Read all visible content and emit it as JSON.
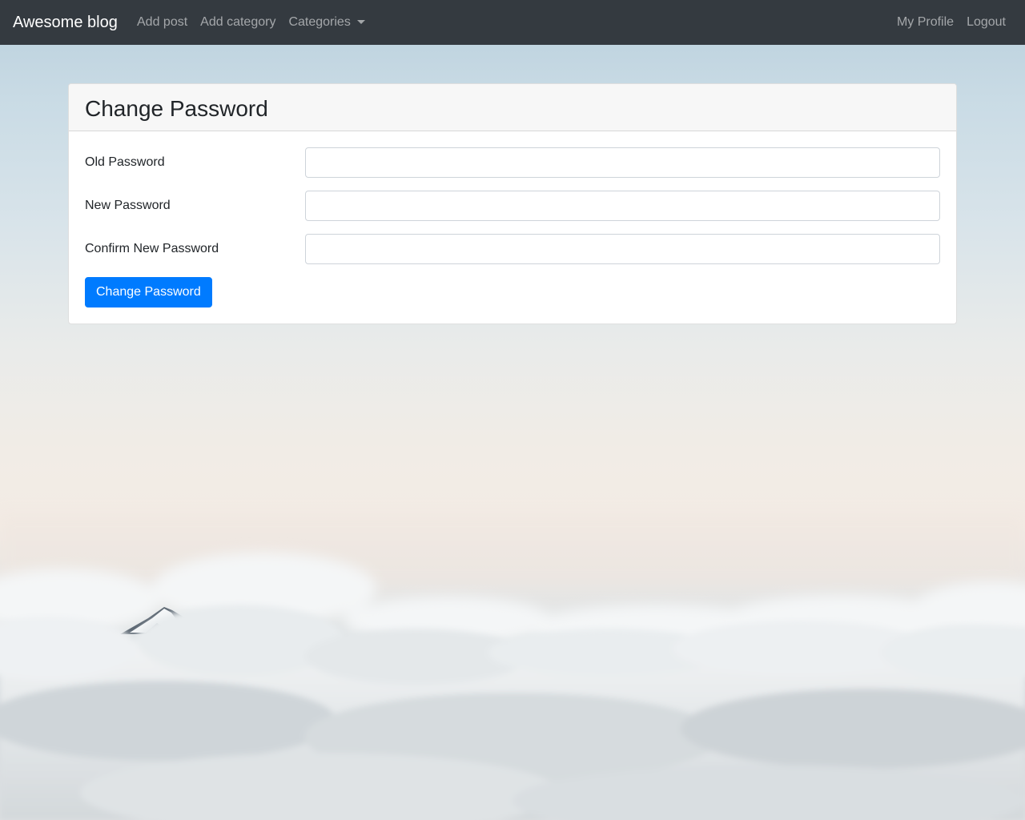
{
  "navbar": {
    "brand": "Awesome blog",
    "left_links": [
      "Add post",
      "Add category"
    ],
    "categories_dropdown": "Categories",
    "right_links": [
      "My Profile",
      "Logout"
    ],
    "background_color": "#343a40"
  },
  "card": {
    "title": "Change Password",
    "fields": [
      {
        "label": "Old Password",
        "value": "",
        "placeholder": ""
      },
      {
        "label": "New Password",
        "value": "",
        "placeholder": ""
      },
      {
        "label": "Confirm New Password",
        "value": "",
        "placeholder": ""
      }
    ],
    "submit_label": "Change Password",
    "accent_color": "#007bff"
  },
  "icons": {
    "dropdown_caret": "chevron-down-icon"
  }
}
